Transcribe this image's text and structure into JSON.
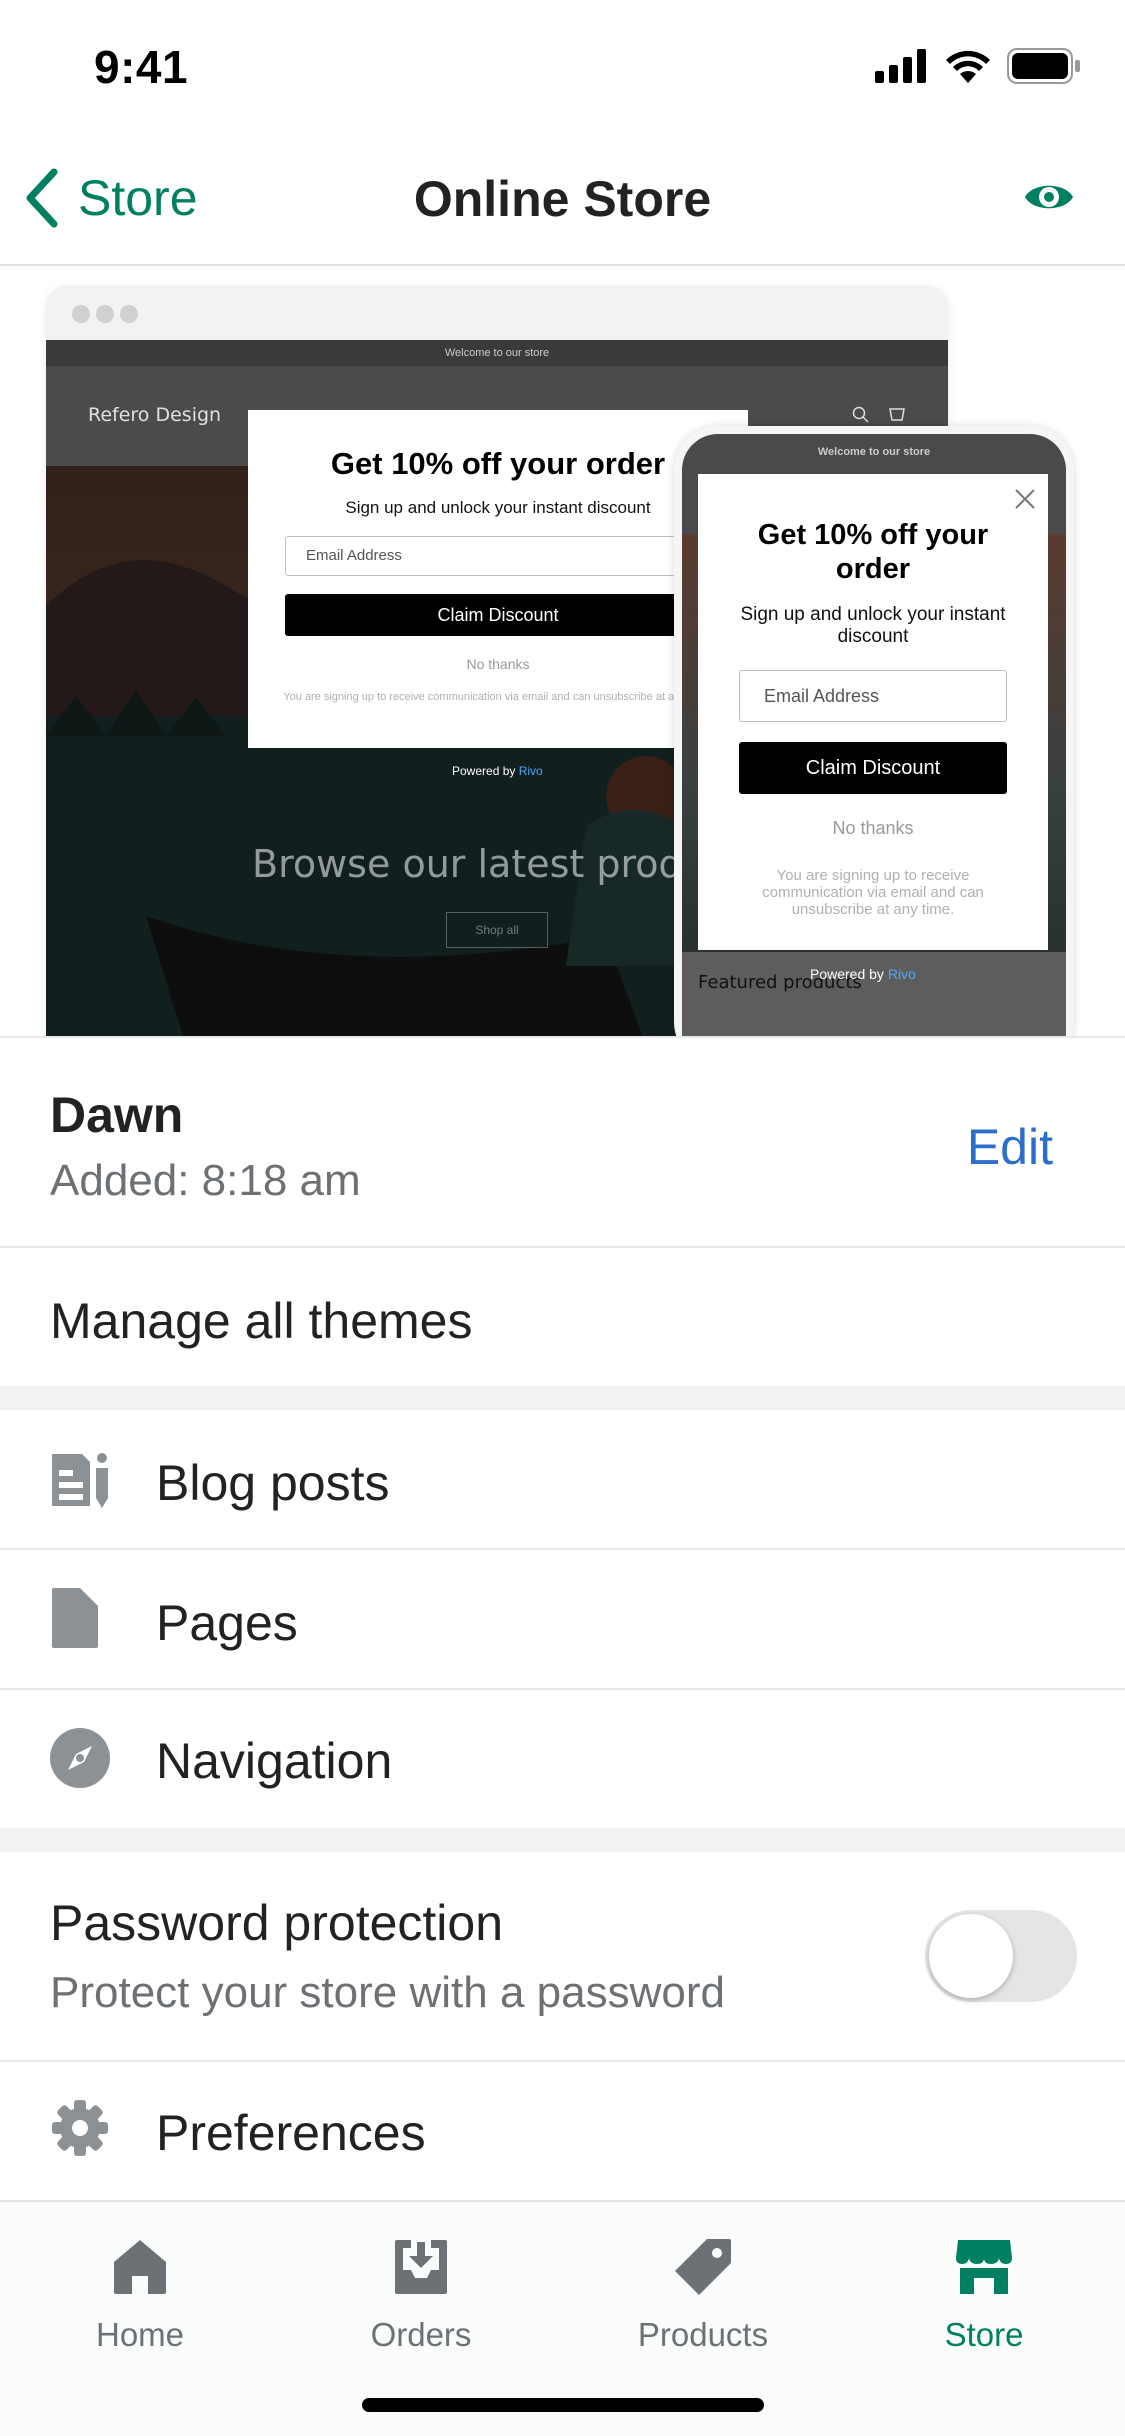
{
  "status_bar": {
    "time": "9:41",
    "icons": [
      "cellular-icon",
      "wifi-icon",
      "battery-icon"
    ]
  },
  "nav": {
    "back_label": "Store",
    "title": "Online Store",
    "action_icon": "eye-icon",
    "accent": "#008060"
  },
  "preview": {
    "desktop": {
      "announcement": "Welcome to our store",
      "brand": "Refero Design",
      "hero_text": "Browse our latest products",
      "hero_button": "Shop all",
      "popup": {
        "title": "Get 10% off your order",
        "subtitle": "Sign up and unlock your instant discount",
        "email_placeholder": "Email Address",
        "button": "Claim Discount",
        "dismiss": "No thanks",
        "legal": "You are signing up to receive communication via email and can unsubscribe at any time.",
        "powered_prefix": "Powered by",
        "powered_brand": "Rivo"
      }
    },
    "mobile": {
      "announcement": "Welcome to our store",
      "featured": "Featured products",
      "popup": {
        "title": "Get 10% off your order",
        "subtitle": "Sign up and unlock your instant discount",
        "email_placeholder": "Email Address",
        "button": "Claim Discount",
        "dismiss": "No thanks",
        "legal": "You are signing up to receive communication via email and can unsubscribe at any time.",
        "powered_prefix": "Powered by",
        "powered_brand": "Rivo"
      }
    }
  },
  "theme": {
    "name": "Dawn",
    "added": "Added: 8:18 am",
    "edit_label": "Edit",
    "edit_color": "#2c6ecb"
  },
  "manage_themes": "Manage all themes",
  "content_items": [
    {
      "label": "Blog posts",
      "icon": "blog-posts-icon"
    },
    {
      "label": "Pages",
      "icon": "page-icon"
    },
    {
      "label": "Navigation",
      "icon": "compass-icon"
    }
  ],
  "password": {
    "title": "Password protection",
    "subtitle": "Protect your store with a password",
    "enabled": false
  },
  "preferences": {
    "label": "Preferences",
    "icon": "gear-icon"
  },
  "tabs": [
    {
      "label": "Home",
      "icon": "home-icon",
      "active": false
    },
    {
      "label": "Orders",
      "icon": "orders-icon",
      "active": false
    },
    {
      "label": "Products",
      "icon": "tag-icon",
      "active": false
    },
    {
      "label": "Store",
      "icon": "store-icon",
      "active": true
    }
  ]
}
